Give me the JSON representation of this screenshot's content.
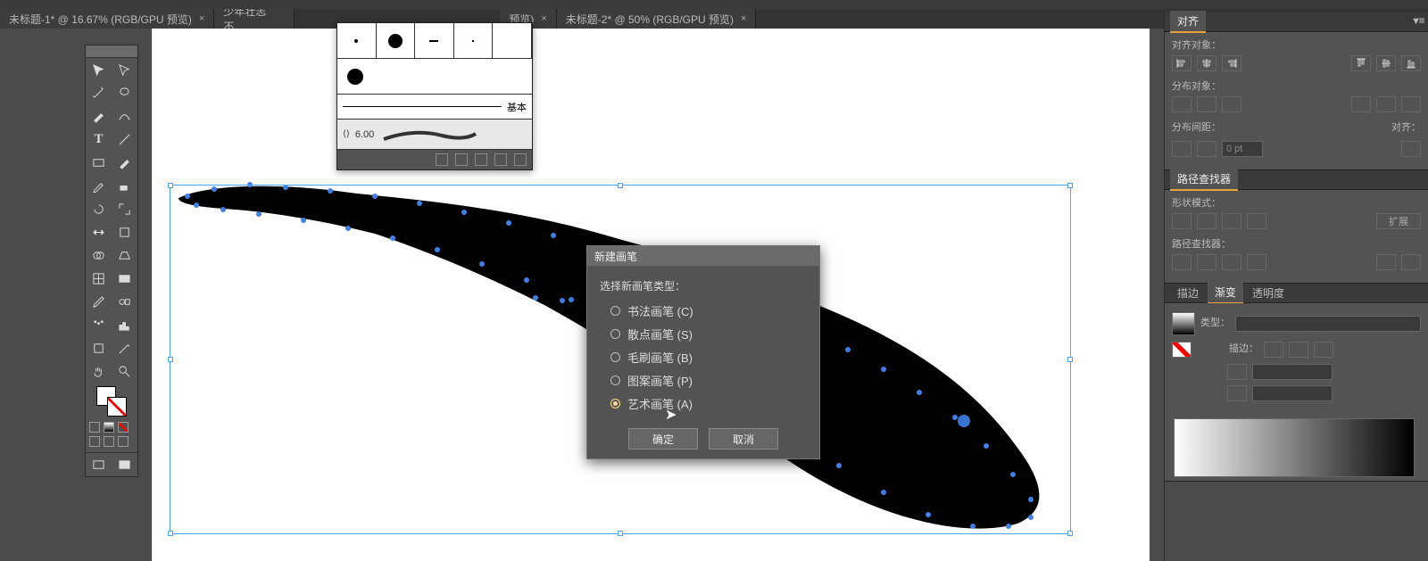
{
  "tabs": [
    {
      "label": "未标题-1* @ 16.67% (RGB/GPU 预览)"
    },
    {
      "label": "少年壮志不..."
    },
    {
      "label": "预览)"
    },
    {
      "label": "未标题-2* @ 50% (RGB/GPU 预览)"
    }
  ],
  "brushpanel": {
    "basic_label": "基本",
    "stroke_value": "6.00"
  },
  "dialog": {
    "title": "新建画笔",
    "prompt": "选择新画笔类型：",
    "options": [
      {
        "label": "书法画笔 (C)",
        "selected": false
      },
      {
        "label": "散点画笔 (S)",
        "selected": false
      },
      {
        "label": "毛刷画笔 (B)",
        "selected": false
      },
      {
        "label": "图案画笔 (P)",
        "selected": false
      },
      {
        "label": "艺术画笔 (A)",
        "selected": true
      }
    ],
    "ok": "确定",
    "cancel": "取消"
  },
  "panels": {
    "align": {
      "tab": "对齐",
      "section1": "对齐对象：",
      "section2": "分布对象：",
      "section3": "分布间距：",
      "section3r": "对齐：",
      "spacing_value": "0 pt"
    },
    "pathfinder": {
      "tab": "路径查找器",
      "section1": "形状模式：",
      "expand": "扩展",
      "section2": "路径查找器："
    },
    "gradient": {
      "tabs": [
        "描边",
        "渐变",
        "透明度"
      ],
      "type_label": "类型：",
      "stroke_label": "描边："
    }
  }
}
